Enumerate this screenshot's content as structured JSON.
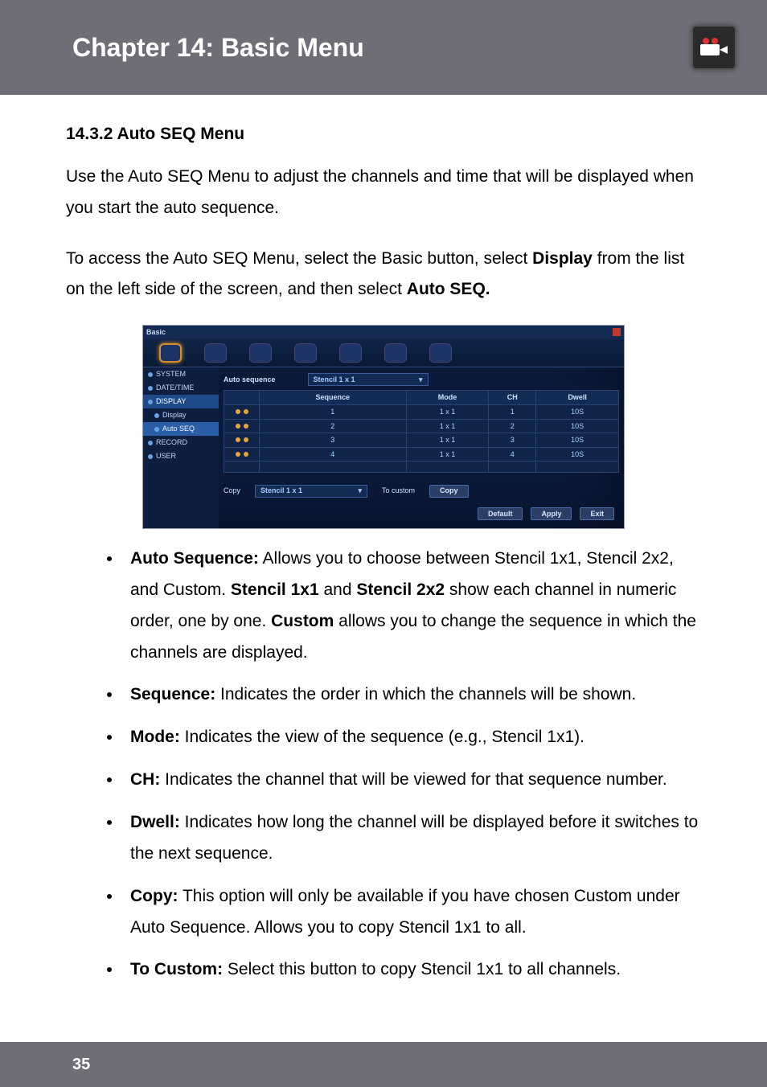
{
  "header": {
    "chapter_title": "Chapter 14: Basic Menu",
    "icon_name": "camera-icon"
  },
  "section": {
    "heading": "14.3.2 Auto SEQ Menu",
    "intro_1": "Use the Auto SEQ Menu to adjust the channels and time that will be displayed when you start the auto sequence.",
    "intro_2a": "To access the Auto SEQ Menu, select the Basic button, select ",
    "intro_2_bold1": "Display",
    "intro_2b": " from the list on the left side of the screen, and then select ",
    "intro_2_bold2": "Auto SEQ."
  },
  "screenshot": {
    "window_title": "Basic",
    "side_items": [
      "SYSTEM",
      "DATE/TIME",
      "DISPLAY",
      "Display",
      "Auto SEQ",
      "RECORD",
      "USER"
    ],
    "dropdown_label": "Auto sequence",
    "dropdown_value": "Stencil 1 x 1",
    "table": {
      "headers": [
        "",
        "Sequence",
        "Mode",
        "CH",
        "Dwell"
      ],
      "rows": [
        {
          "seq": "1",
          "mode": "1 x 1",
          "ch": "1",
          "dwell": "10S"
        },
        {
          "seq": "2",
          "mode": "1 x 1",
          "ch": "2",
          "dwell": "10S"
        },
        {
          "seq": "3",
          "mode": "1 x 1",
          "ch": "3",
          "dwell": "10S"
        },
        {
          "seq": "4",
          "mode": "1 x 1",
          "ch": "4",
          "dwell": "10S"
        }
      ]
    },
    "bottom": {
      "copy_label": "Copy",
      "copy_value": "Stencil 1 x 1",
      "to_custom_label": "To custom",
      "copy_btn": "Copy"
    },
    "actions": {
      "default": "Default",
      "apply": "Apply",
      "exit": "Exit"
    }
  },
  "bullets": [
    {
      "term": "Auto Sequence:",
      "rest_a": " Allows you to choose between Stencil 1x1, Stencil 2x2, and Custom. ",
      "inline_b1": "Stencil 1x1",
      "mid": " and ",
      "inline_b2": "Stencil 2x2",
      "rest_b": " show each channel in numeric order, one by one. ",
      "inline_b3": "Custom",
      "rest_c": " allows you to change the sequence in which the channels are displayed."
    },
    {
      "term": "Sequence:",
      "rest": " Indicates the order in which the channels will be shown."
    },
    {
      "term": "Mode:",
      "rest": " Indicates the view of the sequence (e.g., Stencil 1x1)."
    },
    {
      "term": "CH:",
      "rest": " Indicates the channel that will be viewed for that sequence number."
    },
    {
      "term": "Dwell:",
      "rest": " Indicates how long the channel will be displayed before it switches to the next sequence."
    },
    {
      "term": "Copy:",
      "rest": " This option will only be available if you have chosen Custom under Auto Sequence. Allows you to copy Stencil 1x1 to all."
    },
    {
      "term": "To Custom:",
      "rest": " Select this button to copy Stencil 1x1 to all channels."
    }
  ],
  "footer": {
    "page": "35"
  }
}
